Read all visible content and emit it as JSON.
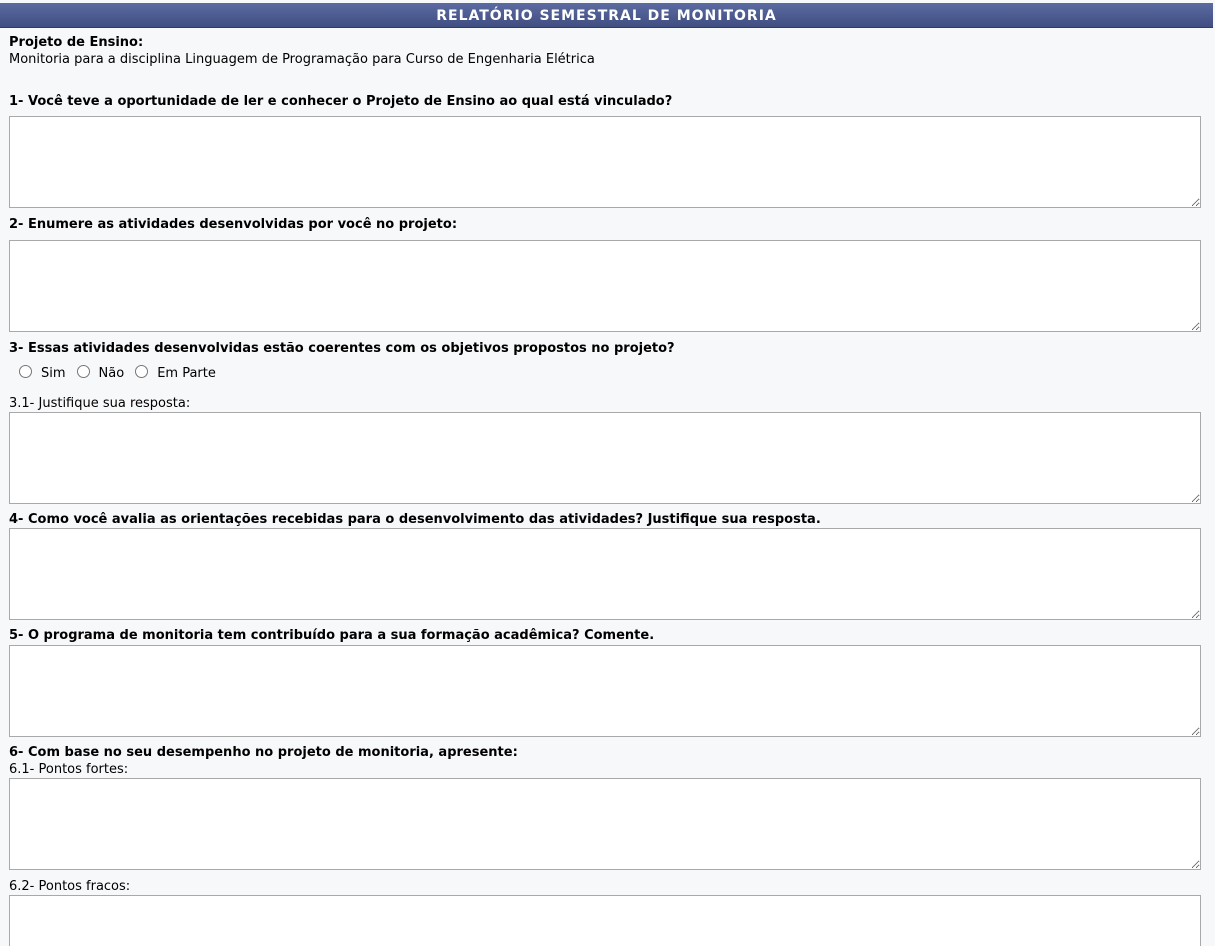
{
  "title": "RELATÓRIO SEMESTRAL DE MONITORIA",
  "project": {
    "label": "Projeto de Ensino:",
    "value": "Monitoria para a disciplina Linguagem de Programação para Curso de Engenharia Elétrica"
  },
  "questions": {
    "q1": "1- Você teve a oportunidade de ler e conhecer o Projeto de Ensino ao qual está vinculado?",
    "q2": "2- Enumere as atividades desenvolvidas por você no projeto:",
    "q3": "3- Essas atividades desenvolvidas estão coerentes com os objetivos propostos no projeto?",
    "q3_options": [
      "Sim",
      "Não",
      "Em Parte"
    ],
    "q3_1": "3.1- Justifique sua resposta:",
    "q4": "4- Como você avalia as orientações recebidas para o desenvolvimento das atividades? Justifique sua resposta.",
    "q5": "5- O programa de monitoria tem contribuído para a sua formação acadêmica? Comente.",
    "q6": "6- Com base no seu desempenho no projeto de monitoria, apresente:",
    "q6_1": "6.1- Pontos fortes:",
    "q6_2": "6.2- Pontos fracos:"
  }
}
